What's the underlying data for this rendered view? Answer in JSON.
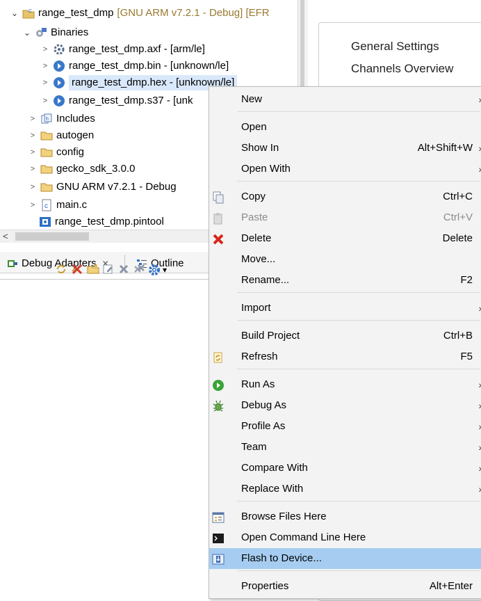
{
  "tree": {
    "project": {
      "name": "range_test_dmp",
      "decoration": "[GNU ARM v7.2.1 - Debug] [EFR"
    },
    "binaries": "Binaries",
    "binary_items": [
      {
        "label": "range_test_dmp.axf - [arm/le]"
      },
      {
        "label": "range_test_dmp.bin - [unknown/le]"
      },
      {
        "label": "range_test_dmp.hex - [unknown/le]"
      },
      {
        "label": "range_test_dmp.s37 - [unk"
      }
    ],
    "items": [
      {
        "label": "Includes"
      },
      {
        "label": "autogen"
      },
      {
        "label": "config"
      },
      {
        "label": "gecko_sdk_3.0.0"
      },
      {
        "label": "GNU ARM v7.2.1 - Debug"
      },
      {
        "label": "main.c"
      },
      {
        "label": "range_test_dmp.pintool"
      }
    ]
  },
  "debug_view": {
    "tab_label": "Debug Adapters",
    "close_glyph": "✕",
    "outline_label": "Outline"
  },
  "editor": {
    "links": [
      "General Settings",
      "Channels Overview"
    ]
  },
  "context_menu": {
    "items": [
      {
        "label": "New",
        "shortcut": "",
        "submenu": true
      },
      {
        "label": "Open",
        "shortcut": ""
      },
      {
        "label": "Show In",
        "shortcut": "Alt+Shift+W",
        "submenu": true
      },
      {
        "label": "Open With",
        "shortcut": "",
        "submenu": true
      },
      {
        "label": "Copy",
        "shortcut": "Ctrl+C",
        "icon": "copy-icon"
      },
      {
        "label": "Paste",
        "shortcut": "Ctrl+V",
        "icon": "paste-icon",
        "disabled": true
      },
      {
        "label": "Delete",
        "shortcut": "Delete",
        "icon": "delete-icon"
      },
      {
        "label": "Move...",
        "shortcut": ""
      },
      {
        "label": "Rename...",
        "shortcut": "F2"
      },
      {
        "label": "Import",
        "shortcut": "",
        "submenu": true
      },
      {
        "label": "Build Project",
        "shortcut": "Ctrl+B"
      },
      {
        "label": "Refresh",
        "shortcut": "F5",
        "icon": "refresh-icon"
      },
      {
        "label": "Run As",
        "shortcut": "",
        "submenu": true,
        "icon": "run-icon"
      },
      {
        "label": "Debug As",
        "shortcut": "",
        "submenu": true,
        "icon": "debug-icon"
      },
      {
        "label": "Profile As",
        "shortcut": "",
        "submenu": true
      },
      {
        "label": "Team",
        "shortcut": "",
        "submenu": true
      },
      {
        "label": "Compare With",
        "shortcut": "",
        "submenu": true
      },
      {
        "label": "Replace With",
        "shortcut": "",
        "submenu": true
      },
      {
        "label": "Browse Files Here",
        "shortcut": "",
        "icon": "browse-files-icon"
      },
      {
        "label": "Open Command Line Here",
        "shortcut": "",
        "icon": "terminal-icon"
      },
      {
        "label": "Flash to Device...",
        "shortcut": "",
        "icon": "flash-device-icon",
        "highlighted": true
      },
      {
        "label": "Properties",
        "shortcut": "Alt+Enter"
      }
    ],
    "submenu_glyph": "›"
  },
  "colors": {
    "menu_highlight": "#a6cdf1",
    "selection": "#d9e8fb",
    "decoration": "#9a7a2f"
  }
}
